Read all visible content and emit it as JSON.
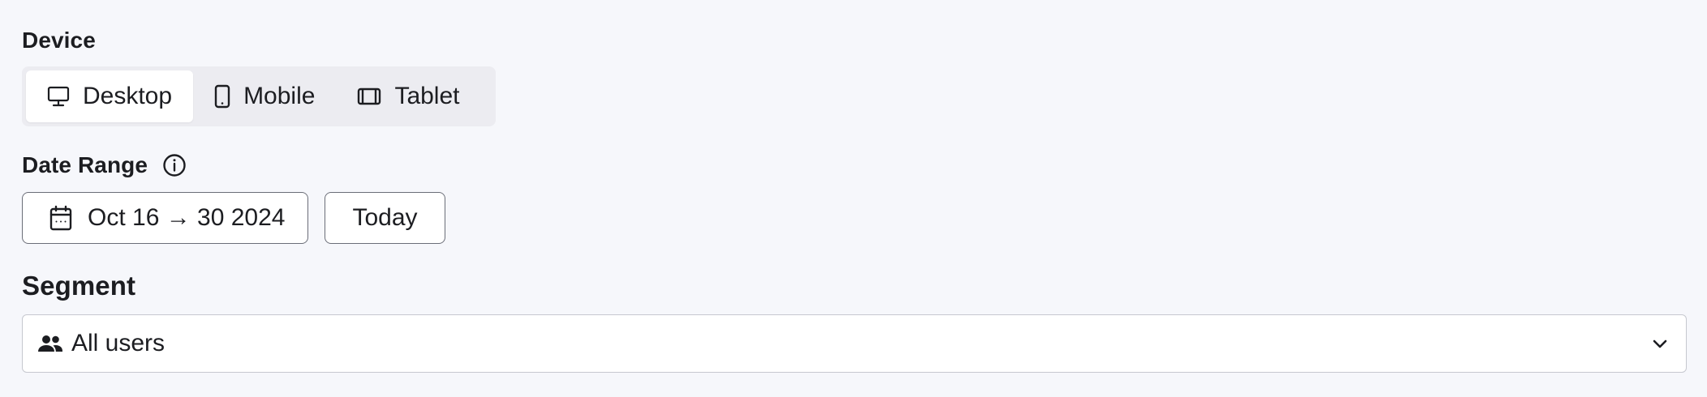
{
  "device": {
    "label": "Device",
    "options": [
      {
        "label": "Desktop",
        "icon": "desktop-icon",
        "selected": true
      },
      {
        "label": "Mobile",
        "icon": "mobile-icon",
        "selected": false
      },
      {
        "label": "Tablet",
        "icon": "tablet-icon",
        "selected": false
      }
    ]
  },
  "date_range": {
    "label": "Date Range",
    "info_icon": "info-icon",
    "range_value": "Oct 16 → 30 2024",
    "range_icon": "calendar-icon",
    "today_label": "Today"
  },
  "segment": {
    "label": "Segment",
    "selected_value": "All users",
    "icon": "users-icon",
    "dropdown_icon": "chevron-down-icon"
  },
  "colors": {
    "background": "#f6f7fb",
    "text": "#1c1d21",
    "border": "#6b6e78",
    "select_border": "#c6c8cf"
  }
}
